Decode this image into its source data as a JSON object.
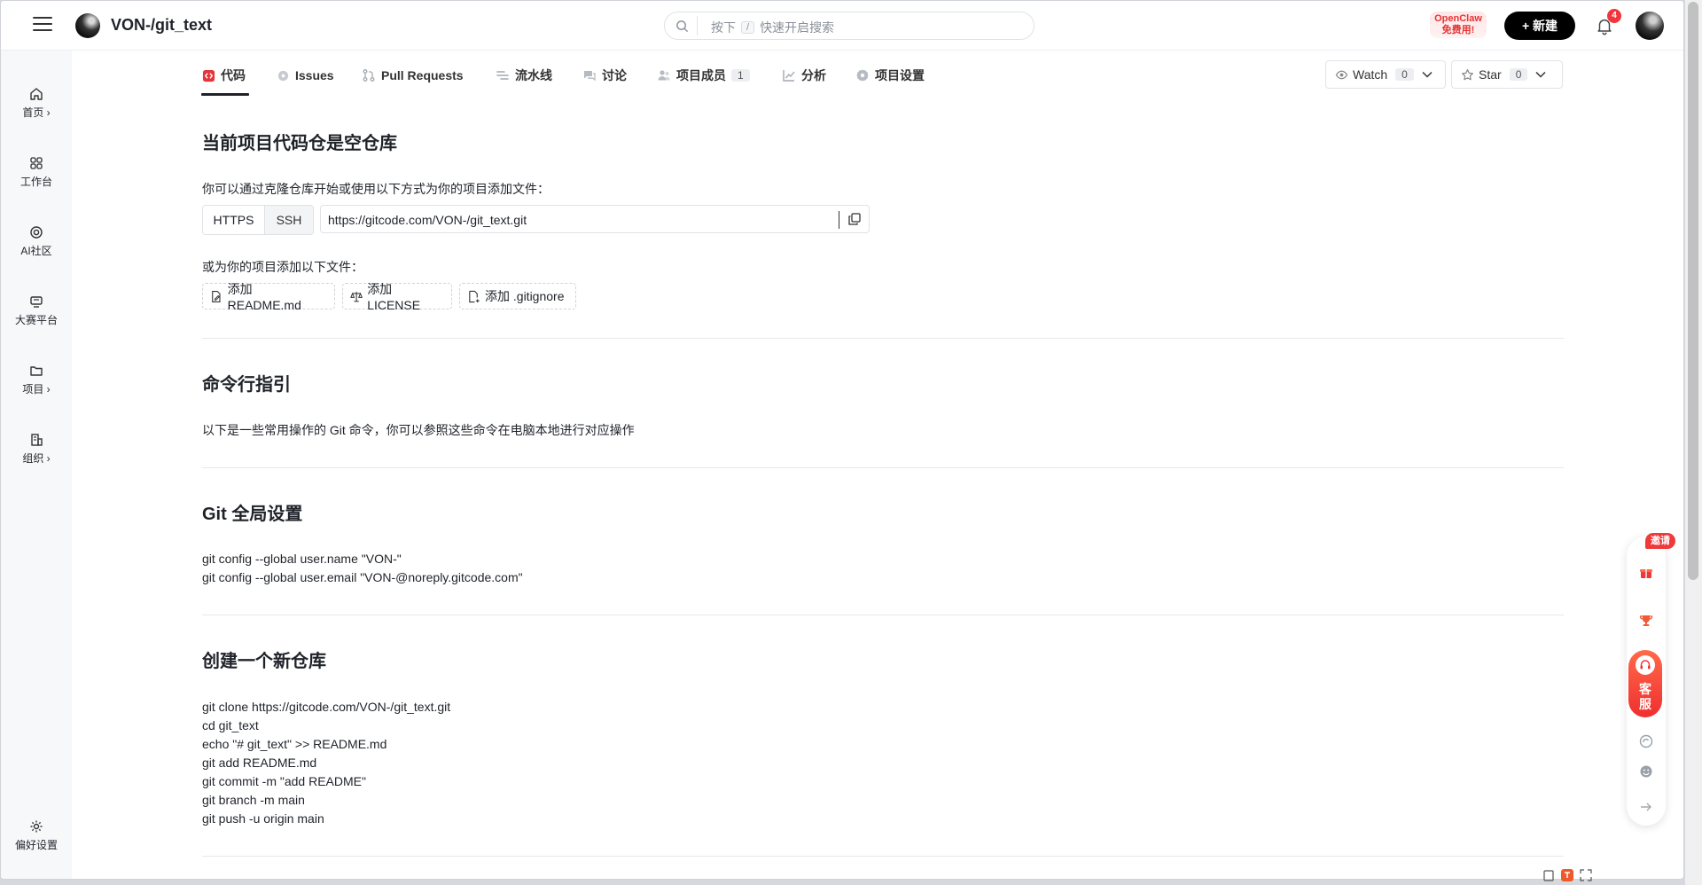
{
  "header": {
    "repo_name": "VON-/git_text",
    "search_prefix": "按下",
    "search_key": "/",
    "search_suffix": "快速开启搜索",
    "promo_line1": "OpenClaw",
    "promo_line2": "免费用!",
    "new_button": "+ 新建",
    "notification_count": "4"
  },
  "sidebar": {
    "items": [
      {
        "label": "首页 ›",
        "icon": "home-icon"
      },
      {
        "label": "工作台",
        "icon": "grid-icon"
      },
      {
        "label": "AI社区",
        "icon": "ai-icon"
      },
      {
        "label": "大赛平台",
        "icon": "trophy-icon"
      },
      {
        "label": "项目 ›",
        "icon": "folder-icon"
      },
      {
        "label": "组织 ›",
        "icon": "building-icon"
      }
    ],
    "bottom_label": "偏好设置"
  },
  "tabs": [
    {
      "label": "代码",
      "icon": "code-icon",
      "active": true
    },
    {
      "label": "Issues",
      "icon": "issue-icon"
    },
    {
      "label": "Pull Requests",
      "icon": "pull-request-icon"
    },
    {
      "label": "流水线",
      "icon": "pipeline-icon"
    },
    {
      "label": "讨论",
      "icon": "discussion-icon"
    },
    {
      "label": "项目成员",
      "icon": "members-icon",
      "count": "1"
    },
    {
      "label": "分析",
      "icon": "analytics-icon"
    },
    {
      "label": "项目设置",
      "icon": "settings-icon"
    }
  ],
  "repo_actions": {
    "watch_label": "Watch",
    "watch_count": "0",
    "star_label": "Star",
    "star_count": "0"
  },
  "empty_repo": {
    "title": "当前项目代码仓是空仓库",
    "clone_hint": "你可以通过克隆仓库开始或使用以下方式为你的项目添加文件：",
    "protocol_https": "HTTPS",
    "protocol_ssh": "SSH",
    "clone_url": "https://gitcode.com/VON-/git_text.git",
    "add_hint": "或为你的项目添加以下文件：",
    "add_readme": "添加 README.md",
    "add_license": "添加 LICENSE",
    "add_gitignore": "添加 .gitignore"
  },
  "cli_guide": {
    "title": "命令行指引",
    "desc": "以下是一些常用操作的 Git 命令，你可以参照这些命令在电脑本地进行对应操作"
  },
  "git_global": {
    "title": "Git 全局设置",
    "lines": [
      "git config --global user.name \"VON-\"",
      "git config --global user.email \"VON-@noreply.gitcode.com\""
    ]
  },
  "new_repo": {
    "title": "创建一个新仓库",
    "lines": [
      "git clone https://gitcode.com/VON-/git_text.git",
      "cd git_text",
      "echo \"# git_text\" >> README.md",
      "git add README.md",
      "git commit -m \"add README\"",
      "git branch -m main",
      "git push -u origin main"
    ]
  },
  "float_bar": {
    "invite_label": "邀请",
    "service_label_1": "客",
    "service_label_2": "服"
  },
  "colors": {
    "accent": "#1f2329",
    "badge": "#f0353c",
    "code_tab_icon": "#e5343a",
    "service": "#ef2f2f"
  }
}
